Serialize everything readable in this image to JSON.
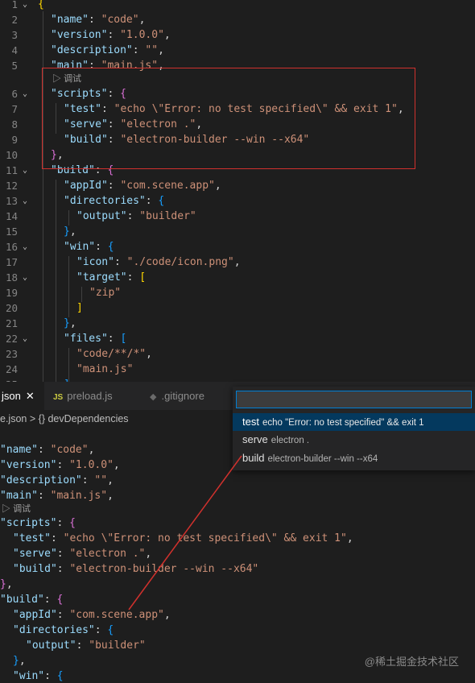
{
  "top_editor": {
    "codelens_label": "调试"
  },
  "tabs": [
    {
      "label": "json",
      "active": true
    },
    {
      "label": "preload.js",
      "icon": "JS",
      "active": false
    },
    {
      "label": ".gitignore",
      "active": false
    }
  ],
  "breadcrumb": {
    "file": "e.json",
    "separator": ">",
    "symbol_icon": "{}",
    "symbol": "devDependencies"
  },
  "bottom_editor": {
    "codelens_label": "调试"
  },
  "quick_pick": {
    "input_value": "",
    "items": [
      {
        "name": "test",
        "description": "echo \"Error: no test specified\" && exit 1",
        "selected": true
      },
      {
        "name": "serve",
        "description": "electron .",
        "selected": false
      },
      {
        "name": "build",
        "description": "electron-builder --win --x64",
        "selected": false
      }
    ]
  },
  "watermark": "@稀土掘金技术社区",
  "colors": {
    "editor_bg": "#1e1e1e",
    "key": "#9cdcfe",
    "string": "#ce9178",
    "bracket_gold": "#ffd700",
    "bracket_purple": "#da70d6",
    "bracket_blue": "#179fff",
    "annotation_red": "#d0312d",
    "selection_blue": "#04395e"
  }
}
